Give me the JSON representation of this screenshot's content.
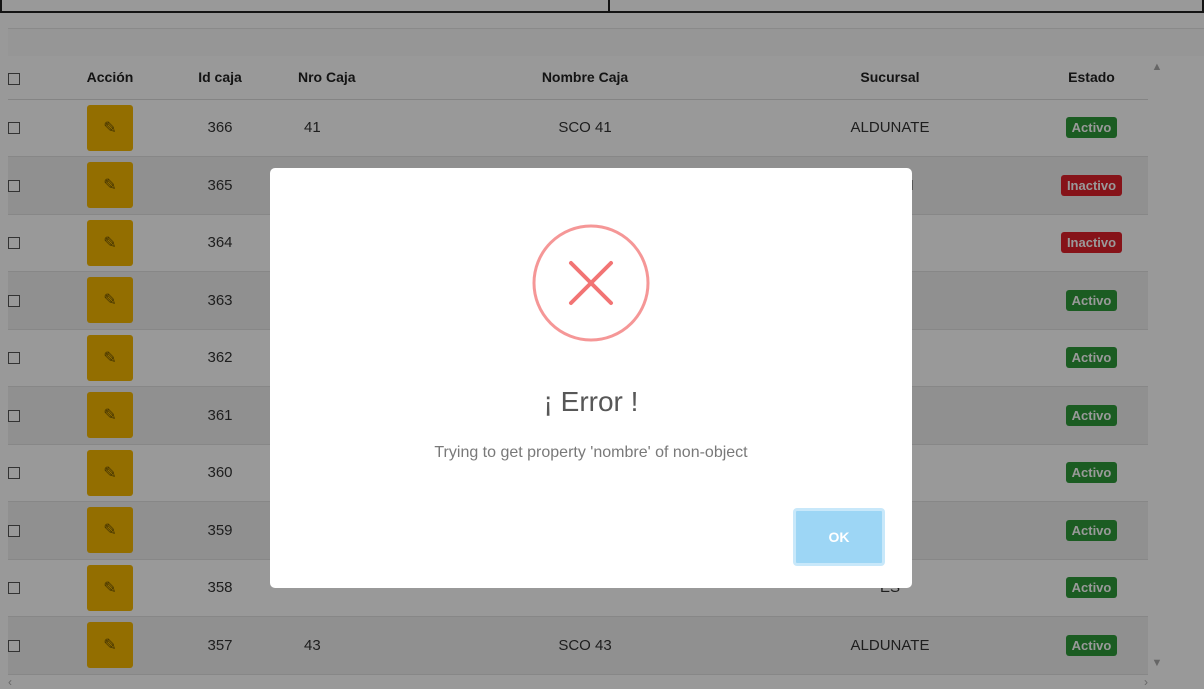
{
  "table": {
    "headers": {
      "accion": "Acción",
      "id_caja": "Id caja",
      "nro_caja": "Nro Caja",
      "nombre_caja": "Nombre Caja",
      "sucursal": "Sucursal",
      "estado": "Estado"
    },
    "rows": [
      {
        "id": "366",
        "nro": "41",
        "nombre": "SCO 41",
        "sucursal": "ALDUNATE",
        "estado": "Activo",
        "status": "active"
      },
      {
        "id": "365",
        "nro": "",
        "nombre": "",
        "sucursal": "ACION",
        "estado": "Inactivo",
        "status": "inactive"
      },
      {
        "id": "364",
        "nro": "",
        "nombre": "",
        "sucursal": "RANA",
        "estado": "Inactivo",
        "status": "inactive"
      },
      {
        "id": "363",
        "nro": "",
        "nombre": "",
        "sucursal": "UTIN",
        "estado": "Activo",
        "status": "active"
      },
      {
        "id": "362",
        "nro": "",
        "nombre": "",
        "sucursal": "UTIN",
        "estado": "Activo",
        "status": "active"
      },
      {
        "id": "361",
        "nro": "",
        "nombre": "",
        "sucursal": "O",
        "estado": "Activo",
        "status": "active"
      },
      {
        "id": "360",
        "nro": "",
        "nombre": "",
        "sucursal": "O",
        "estado": "Activo",
        "status": "active"
      },
      {
        "id": "359",
        "nro": "",
        "nombre": "",
        "sucursal": "ES",
        "estado": "Activo",
        "status": "active"
      },
      {
        "id": "358",
        "nro": "",
        "nombre": "",
        "sucursal": "ES",
        "estado": "Activo",
        "status": "active"
      },
      {
        "id": "357",
        "nro": "43",
        "nombre": "SCO 43",
        "sucursal": "ALDUNATE",
        "estado": "Activo",
        "status": "active"
      }
    ]
  },
  "dialog": {
    "icon": "error-x-icon",
    "title": "¡ Error !",
    "message": "Trying to get property 'nombre' of non-object",
    "ok_label": "OK"
  },
  "colors": {
    "edit_button": "#f5b800",
    "active_badge": "#2e9a3a",
    "inactive_badge": "#e0212b",
    "error_icon": "#f27474",
    "ok_button": "#9dd6f5"
  }
}
